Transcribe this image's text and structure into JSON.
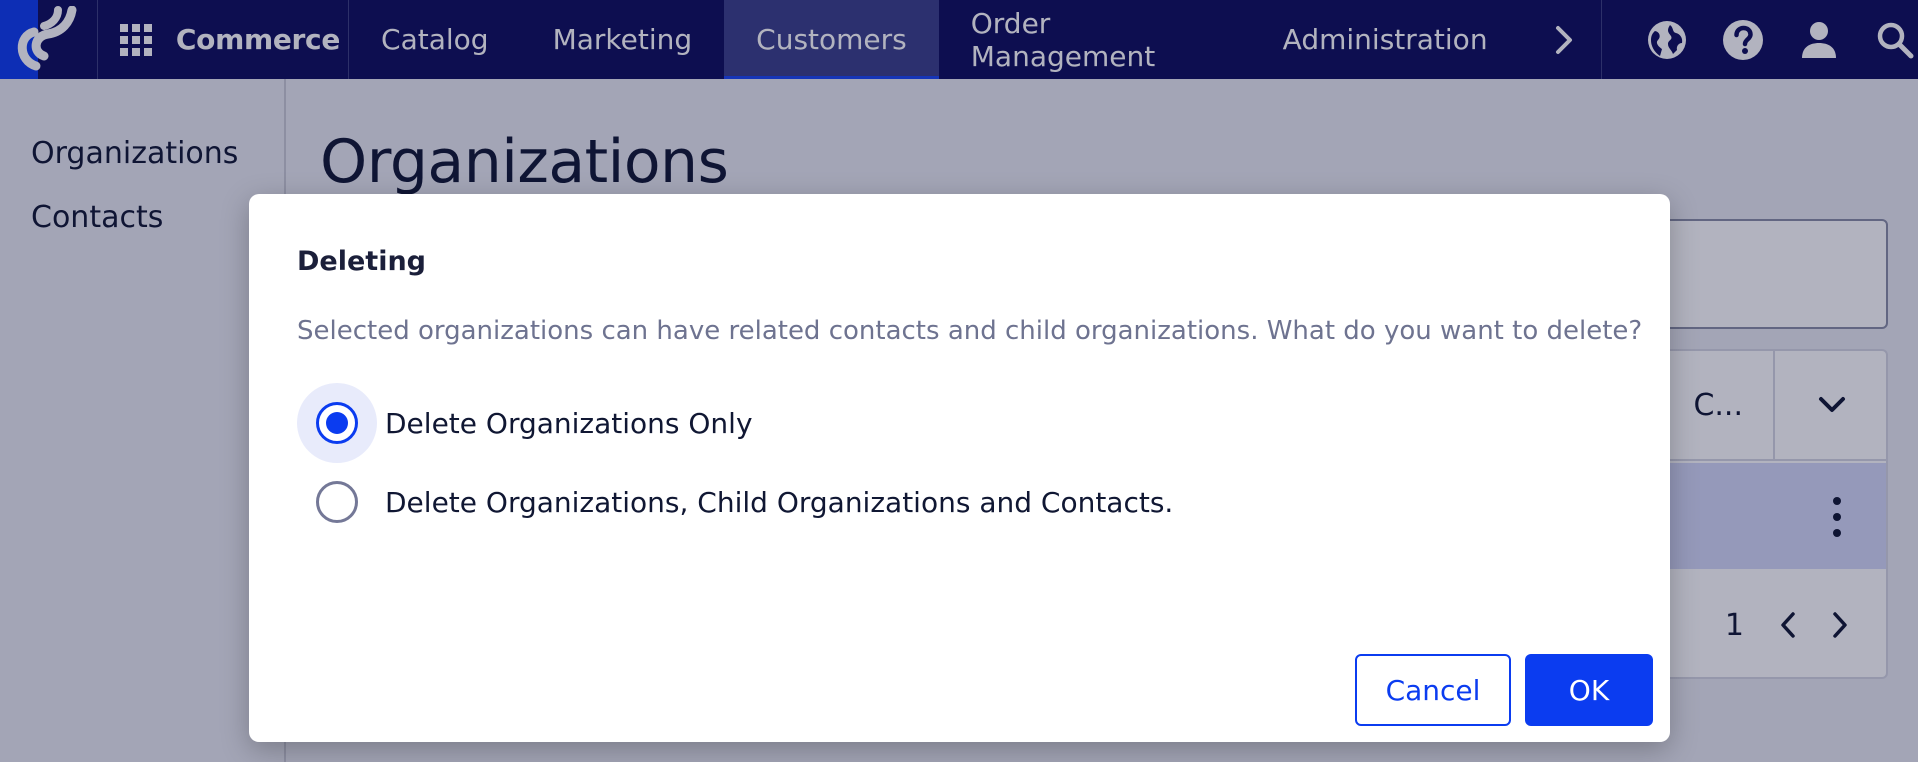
{
  "topbar": {
    "brand_label": "Commerce",
    "nav": [
      "Catalog",
      "Marketing",
      "Customers",
      "Order Management",
      "Administration"
    ],
    "active_nav": "Customers",
    "colors": {
      "bar": "#0c0c5c",
      "accent": "#0b3cf0",
      "active_tab": "#3a3f8a"
    },
    "icons": [
      "app-grid-icon",
      "chevron-right-icon",
      "globe-icon",
      "help-icon",
      "user-icon",
      "search-icon"
    ]
  },
  "sidebar": {
    "items": [
      {
        "label": "Organizations"
      },
      {
        "label": "Contacts"
      }
    ]
  },
  "main": {
    "title": "Organizations",
    "table": {
      "header_col": "C...",
      "pager_page": "1"
    }
  },
  "dialog": {
    "title": "Deleting",
    "message": "Selected organizations can have related contacts and child organizations. What do you want to delete?",
    "options": [
      {
        "label": "Delete Organizations Only",
        "selected": true
      },
      {
        "label": "Delete Organizations, Child Organizations and Contacts.",
        "selected": false
      }
    ],
    "cancel_label": "Cancel",
    "ok_label": "OK"
  }
}
